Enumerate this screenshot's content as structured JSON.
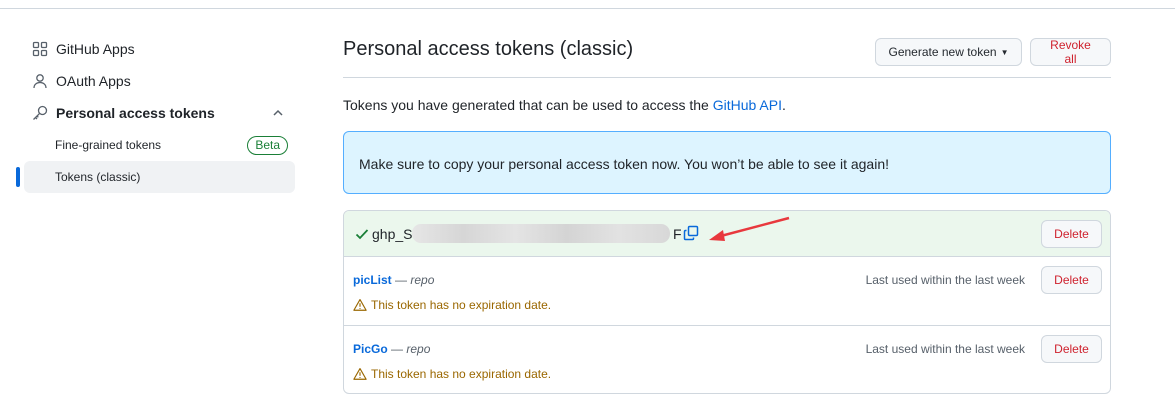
{
  "sidebar": {
    "items": [
      {
        "label": "GitHub Apps",
        "icon": "apps-grid-icon"
      },
      {
        "label": "OAuth Apps",
        "icon": "person-icon"
      },
      {
        "label": "Personal access tokens",
        "icon": "key-icon"
      }
    ],
    "sub_items": [
      {
        "label": "Fine-grained tokens",
        "badge": "Beta"
      },
      {
        "label": "Tokens (classic)",
        "active": true
      }
    ]
  },
  "main": {
    "title": "Personal access tokens (classic)",
    "generate_label": "Generate new token",
    "revoke_label": "Revoke all",
    "intro_text": "Tokens you have generated that can be used to access the ",
    "intro_link": "GitHub API",
    "intro_end": ".",
    "flash_text": "Make sure to copy your personal access token now. You won’t be able to see it again!"
  },
  "new_token": {
    "prefix": "ghp_S",
    "suffix": "F",
    "delete_label": "Delete"
  },
  "tokens": [
    {
      "name": "picList",
      "dash": " — ",
      "scope": "repo",
      "warning": "This token has no expiration date.",
      "last_used": "Last used within the last week",
      "delete_label": "Delete"
    },
    {
      "name": "PicGo",
      "dash": " — ",
      "scope": "repo",
      "warning": "This token has no expiration date.",
      "last_used": "Last used within the last week",
      "delete_label": "Delete"
    }
  ],
  "colors": {
    "accent": "#0969da",
    "danger": "#cf222e",
    "success": "#1a7f37",
    "attention": "#9a6700",
    "annotation_arrow": "#e8383d"
  }
}
